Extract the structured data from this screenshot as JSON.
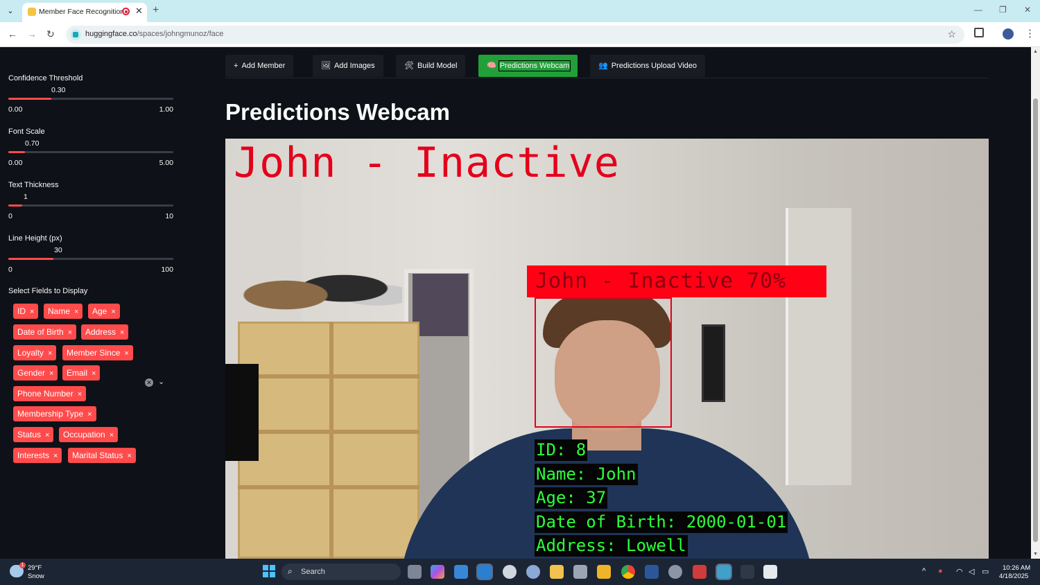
{
  "browser": {
    "tab_title": "Member Face Recognition",
    "tab_close": "✕",
    "new_tab": "+",
    "url_host": "huggingface.co",
    "url_path": "/spaces/johngmunoz/face",
    "win_minimize": "—",
    "win_restore": "❐",
    "win_close": "✕"
  },
  "sidebar": {
    "sliders": [
      {
        "label": "Confidence Threshold",
        "value": "0.30",
        "min": "0.00",
        "max": "1.00",
        "fraction": 0.3
      },
      {
        "label": "Font Scale",
        "value": "0.70",
        "min": "0.00",
        "max": "5.00",
        "fraction": 0.14
      },
      {
        "label": "Text Thickness",
        "value": "1",
        "min": "0",
        "max": "10",
        "fraction": 0.1
      },
      {
        "label": "Line Height (px)",
        "value": "30",
        "min": "0",
        "max": "100",
        "fraction": 0.3
      }
    ],
    "fields_label": "Select Fields to Display",
    "fields": [
      "ID",
      "Name",
      "Age",
      "Date of Birth",
      "Address",
      "Loyalty",
      "Member Since",
      "Gender",
      "Email",
      "Phone Number",
      "Membership Type",
      "Status",
      "Occupation",
      "Interests",
      "Marital Status"
    ],
    "chip_close": "×"
  },
  "tabs": [
    {
      "label": "Add Member",
      "icon": "plus-icon",
      "glyph": "+"
    },
    {
      "label": "Add Images",
      "icon": "images-icon",
      "glyph": "🖼"
    },
    {
      "label": "Build Model",
      "icon": "tools-icon",
      "glyph": "🛠"
    },
    {
      "label": "Predictions Webcam",
      "icon": "brain-icon",
      "glyph": "🧠"
    },
    {
      "label": "Predictions Upload Video",
      "icon": "people-icon",
      "glyph": "👥"
    }
  ],
  "active_tab": "Predictions Webcam",
  "page_title": "Predictions Webcam",
  "webcam": {
    "banner_text": "John - Inactive",
    "face_label": "John - Inactive 70%",
    "info_lines": [
      "ID: 8",
      "Name: John",
      "Age: 37",
      "Date of Birth: 2000-01-01",
      "Address: Lowell"
    ]
  },
  "taskbar": {
    "temperature": "29°F",
    "condition": "Snow",
    "weather_badge": "1",
    "search_placeholder": "Search",
    "time": "10:26 AM",
    "date": "4/18/2025"
  },
  "colors": {
    "accent": "#ff4b4b",
    "active_tab": "#21a03a",
    "overlay_red": "#e4001a",
    "overlay_green": "#2cff3a",
    "background": "#0e1117"
  }
}
